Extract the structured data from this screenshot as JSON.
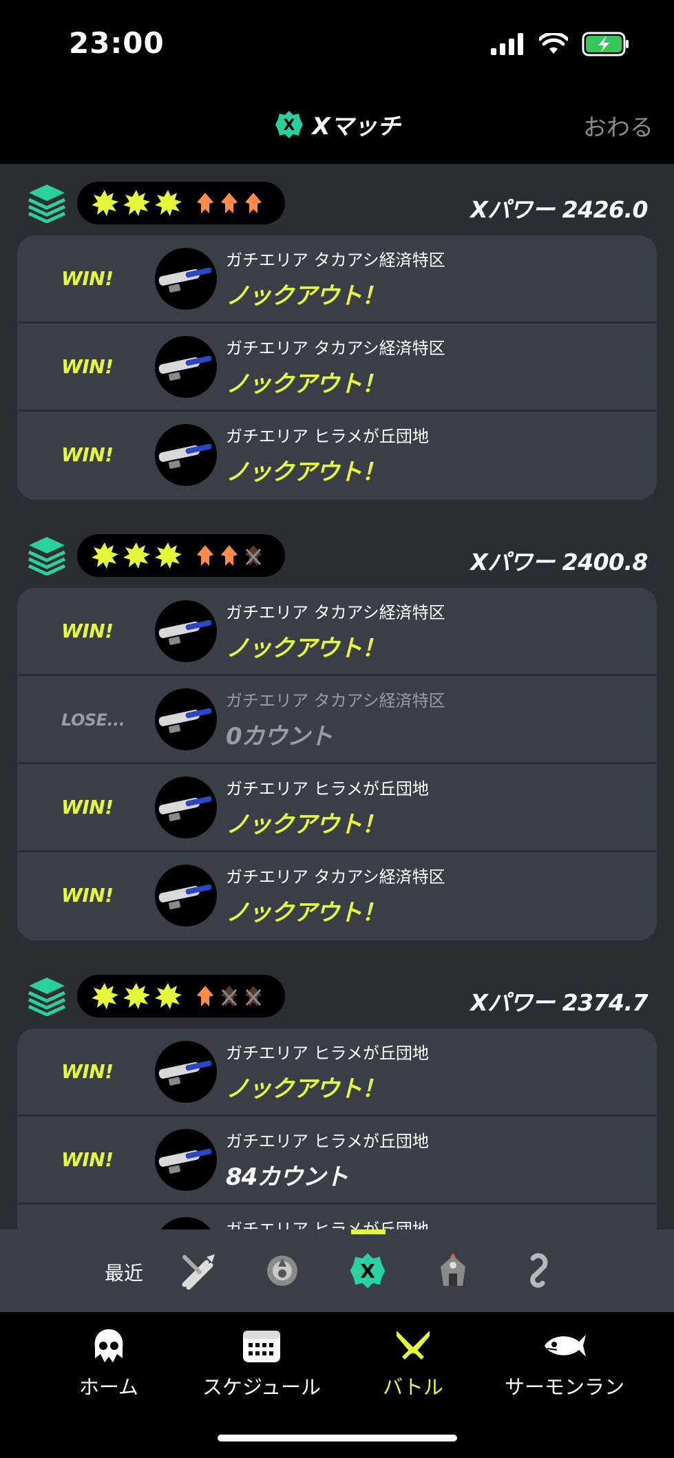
{
  "status": {
    "time": "23:00"
  },
  "header": {
    "title": "Xマッチ",
    "close_label": "おわる"
  },
  "groups": [
    {
      "xpower_label": "Xパワー 2426.0",
      "wins": 3,
      "losses": 0,
      "matches": [
        {
          "result": "WIN!",
          "stage": "ガチエリア タカアシ経済特区",
          "outcome": "ノックアウト！"
        },
        {
          "result": "WIN!",
          "stage": "ガチエリア タカアシ経済特区",
          "outcome": "ノックアウト！"
        },
        {
          "result": "WIN!",
          "stage": "ガチエリア ヒラメが丘団地",
          "outcome": "ノックアウト！"
        }
      ]
    },
    {
      "xpower_label": "Xパワー 2400.8",
      "wins": 3,
      "losses": 1,
      "matches": [
        {
          "result": "WIN!",
          "stage": "ガチエリア タカアシ経済特区",
          "outcome": "ノックアウト！"
        },
        {
          "result": "LOSE...",
          "stage": "ガチエリア タカアシ経済特区",
          "outcome": "0カウント"
        },
        {
          "result": "WIN!",
          "stage": "ガチエリア ヒラメが丘団地",
          "outcome": "ノックアウト！"
        },
        {
          "result": "WIN!",
          "stage": "ガチエリア タカアシ経済特区",
          "outcome": "ノックアウト！"
        }
      ]
    },
    {
      "xpower_label": "Xパワー 2374.7",
      "wins": 3,
      "losses": 2,
      "matches": [
        {
          "result": "WIN!",
          "stage": "ガチエリア ヒラメが丘団地",
          "outcome": "ノックアウト！"
        },
        {
          "result": "WIN!",
          "stage": "ガチエリア ヒラメが丘団地",
          "outcome": "84カウント"
        },
        {
          "result": "",
          "stage": "ガチエリア ヒラメが丘団地",
          "outcome": ""
        }
      ]
    }
  ],
  "mode_bar": {
    "recent_label": "最近",
    "icons": [
      "regular-battle-icon",
      "bankara-battle-icon",
      "x-match-icon",
      "event-match-icon",
      "private-match-icon"
    ],
    "selected": "x-match-icon"
  },
  "tabs": [
    {
      "label": "ホーム",
      "icon": "squid-home-icon"
    },
    {
      "label": "スケジュール",
      "icon": "calendar-icon"
    },
    {
      "label": "バトル",
      "icon": "crossed-weapons-icon",
      "active": true
    },
    {
      "label": "サーモンラン",
      "icon": "salmon-icon"
    }
  ],
  "colors": {
    "accent": "#e6f83b",
    "card": "#3a3e46",
    "background": "#2a2d33",
    "x_green": "#2ad0a0",
    "squid_orange": "#ff8a4a"
  }
}
